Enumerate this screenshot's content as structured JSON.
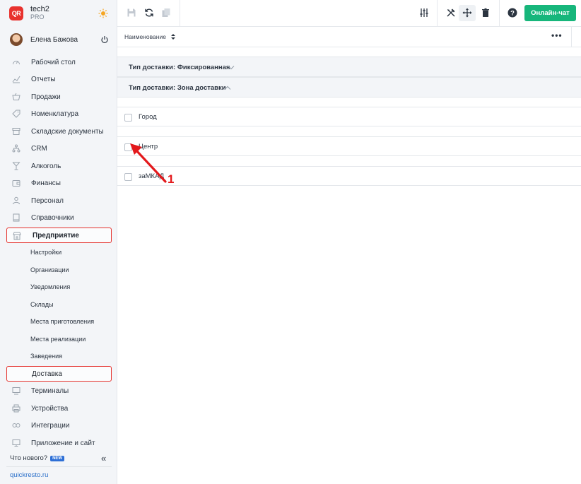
{
  "brand": {
    "logo_text": "QR",
    "name": "tech2",
    "plan": "PRO"
  },
  "user": {
    "name": "Елена Бажова"
  },
  "sidebar": {
    "items": [
      {
        "label": "Рабочий стол",
        "icon": "gauge-icon"
      },
      {
        "label": "Отчеты",
        "icon": "chart-icon"
      },
      {
        "label": "Продажи",
        "icon": "basket-icon"
      },
      {
        "label": "Номенклатура",
        "icon": "tag-icon"
      },
      {
        "label": "Складские документы",
        "icon": "archive-icon"
      },
      {
        "label": "CRM",
        "icon": "hierarchy-icon"
      },
      {
        "label": "Алкоголь",
        "icon": "glass-icon"
      },
      {
        "label": "Финансы",
        "icon": "wallet-icon"
      },
      {
        "label": "Персонал",
        "icon": "person-icon"
      },
      {
        "label": "Справочники",
        "icon": "book-icon"
      }
    ],
    "active_section": {
      "label": "Предприятие",
      "icon": "store-icon"
    },
    "sub_items": [
      "Настройки",
      "Организации",
      "Уведомления",
      "Склады",
      "Места приготовления",
      "Места реализации",
      "Заведения"
    ],
    "active_sub": "Доставка",
    "bottom_items": [
      {
        "label": "Терминалы",
        "icon": "terminal-icon"
      },
      {
        "label": "Устройства",
        "icon": "printer-icon"
      },
      {
        "label": "Интеграции",
        "icon": "link-icon"
      },
      {
        "label": "Приложение и сайт",
        "icon": "monitor-icon"
      }
    ],
    "whats_new": "Что нового?",
    "new_badge": "NEW",
    "collapse_glyph": "«",
    "site_link": "quickresto.ru"
  },
  "toolbar": {
    "chat_label": "Онлайн-чат",
    "icons": [
      "save-icon",
      "refresh-icon",
      "copy-icon",
      "sliders-icon",
      "tools-icon",
      "move-icon",
      "trash-icon",
      "help-icon"
    ]
  },
  "table": {
    "column_header": "Наименование",
    "more_glyph": "•••",
    "groups": [
      {
        "label": "Тип доставки: Фиксированная",
        "expanded": false
      },
      {
        "label": "Тип доставки: Зона доставки",
        "expanded": true
      }
    ],
    "rows": [
      "Город",
      "Центр",
      "заМКАД"
    ]
  },
  "annotation": {
    "number": "1",
    "color": "#e3191c"
  },
  "colors": {
    "accent_green": "#17b67b",
    "highlight_red": "#e5312c",
    "link_blue": "#2a6fc9"
  }
}
